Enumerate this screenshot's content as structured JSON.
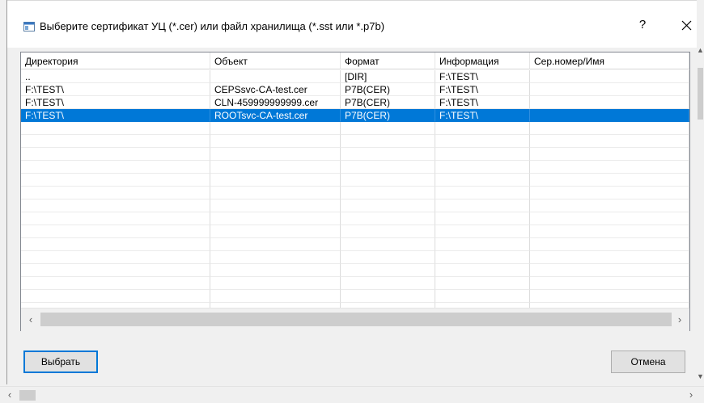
{
  "window": {
    "title": "Выберите сертификат УЦ (*.cer) или файл хранилища (*.sst или *.p7b)",
    "help_label": "?"
  },
  "table": {
    "columns": [
      "Директория",
      "Объект",
      "Формат",
      "Информация",
      "Сер.номер/Имя"
    ],
    "rows": [
      [
        "..",
        "",
        "[DIR]",
        "F:\\TEST\\",
        ""
      ],
      [
        "F:\\TEST\\",
        "CEPSsvc-CA-test.cer",
        "P7B(CER)",
        "F:\\TEST\\",
        ""
      ],
      [
        "F:\\TEST\\",
        "CLN-459999999999.cer",
        "P7B(CER)",
        "F:\\TEST\\",
        ""
      ],
      [
        "F:\\TEST\\",
        "ROOTsvc-CA-test.cer",
        "P7B(CER)",
        "F:\\TEST\\",
        ""
      ]
    ],
    "selected_row": 3
  },
  "buttons": {
    "choose": "Выбрать",
    "cancel": "Отмена"
  },
  "icons": {
    "app": "app-window-icon",
    "close": "close-icon",
    "scroll_left": "chevron-left-icon",
    "scroll_right": "chevron-right-icon"
  },
  "colors": {
    "selection": "#0078d7",
    "background": "#f0f0f0"
  }
}
